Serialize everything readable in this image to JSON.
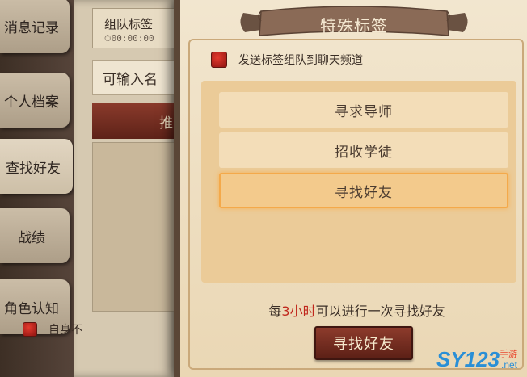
{
  "sidebar": {
    "tabs": [
      {
        "label": "消息记录"
      },
      {
        "label": "个人档案"
      },
      {
        "label": "查找好友"
      },
      {
        "label": "战绩"
      },
      {
        "label": "角色认知"
      }
    ],
    "active_tab": "查找好友"
  },
  "team_panel": {
    "title": "组队标签",
    "timer": "00:00:00",
    "input_placeholder": "可输入名",
    "button_label": "推",
    "self_check_label": "自身不"
  },
  "dialog": {
    "title": "特殊标签",
    "broadcast_label": "发送标签组队到聊天频道",
    "options": [
      {
        "label": "寻求导师",
        "selected": false
      },
      {
        "label": "招收学徒",
        "selected": false
      },
      {
        "label": "寻找好友",
        "selected": true
      }
    ],
    "info_prefix": "每",
    "info_highlight": "3小时",
    "info_suffix": "可以进行一次寻找好友",
    "action_label": "寻找好友"
  },
  "watermark": {
    "logo": "SY123",
    "sub": "手游",
    "net": ".net"
  },
  "colors": {
    "accent_red": "#c0271c",
    "button_dark_red": "#8d3b2c",
    "selected_border": "#f4a94a",
    "watermark_blue": "#2a8fd6"
  }
}
